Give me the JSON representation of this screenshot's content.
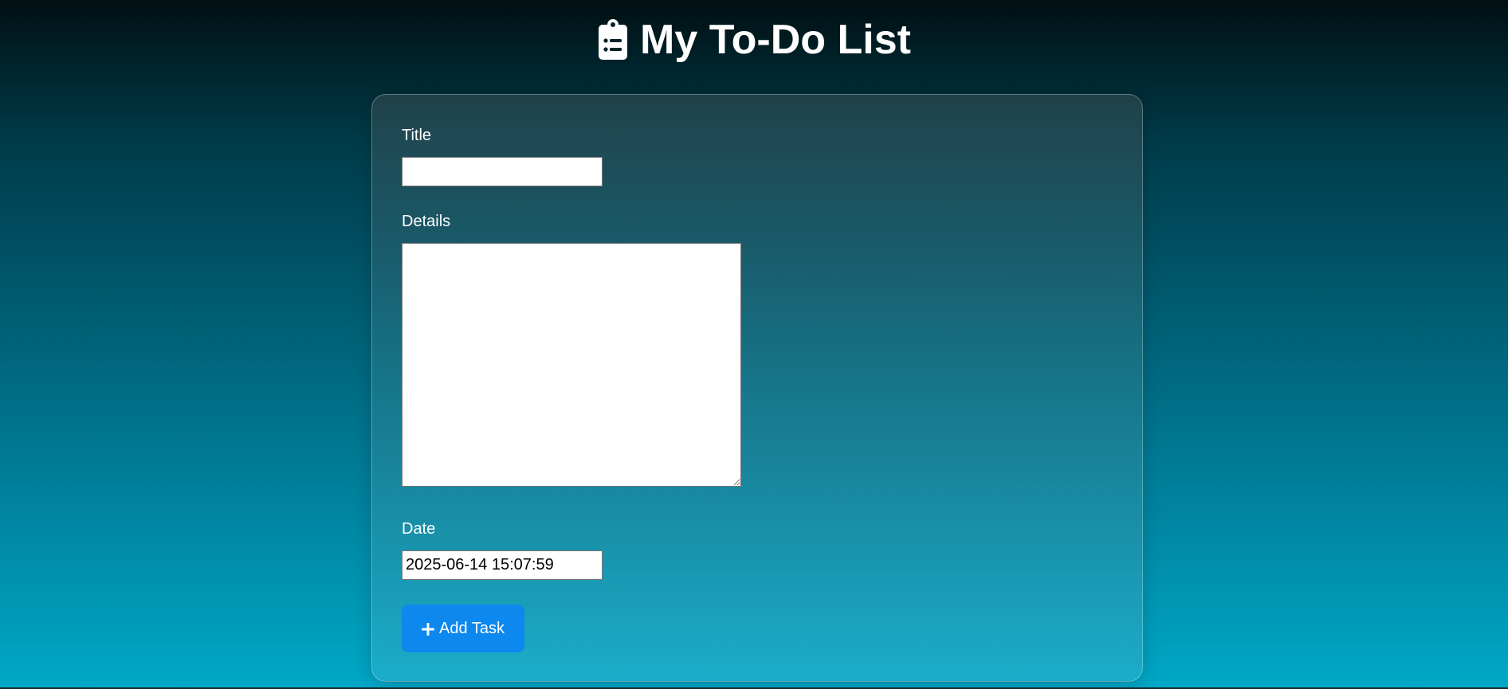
{
  "header": {
    "icon": "clipboard-list-icon",
    "title": "My To-Do List"
  },
  "form": {
    "title_label": "Title",
    "title_value": "",
    "details_label": "Details",
    "details_value": "",
    "date_label": "Date",
    "date_value": "2025-06-14 15:07:59",
    "add_button": {
      "icon": "plus-icon",
      "label": "Add Task"
    }
  },
  "colors": {
    "button": "#0d88ef",
    "background_top": "#000f12",
    "background_bottom": "#00a8c8"
  }
}
